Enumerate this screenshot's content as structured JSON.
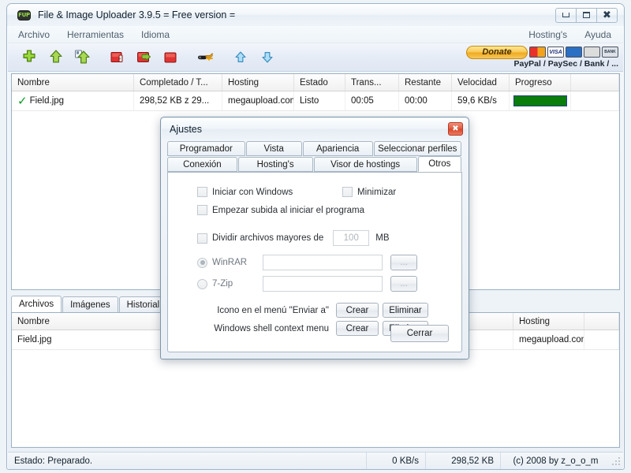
{
  "window": {
    "title": "File & Image Uploader 3.9.5  = Free version =",
    "app_icon": "FUP",
    "buttons": {
      "minimize": "minimize-icon",
      "maximize": "maximize-icon",
      "close": "close-icon"
    }
  },
  "menubar": {
    "left": [
      "Archivo",
      "Herramientas",
      "Idioma"
    ],
    "right": [
      "Hosting's",
      "Ayuda"
    ]
  },
  "toolbar": {
    "icons": [
      "add-file-icon",
      "upload-icon",
      "upload-queue-icon",
      "delete-icon",
      "resume-icon",
      "stop-icon",
      "settings-key-icon",
      "move-up-icon",
      "move-down-icon"
    ],
    "donate_label": "Donate",
    "donate_caption": "PayPal / PaySec / Bank / ...",
    "cards": [
      "MC",
      "VISA",
      "AMEX",
      "DISC",
      "BANK"
    ]
  },
  "upper_grid": {
    "columns": [
      "Nombre",
      "Completado / T...",
      "Hosting",
      "Estado",
      "Trans...",
      "Restante",
      "Velocidad",
      "Progreso",
      ""
    ],
    "rows": [
      {
        "status_icon": "check-icon",
        "name": "Field.jpg",
        "completed": "298,52 KB z 29...",
        "hosting": "megaupload.com",
        "estado": "Listo",
        "transcurrido": "00:05",
        "restante": "00:00",
        "velocidad": "59,6 KB/s",
        "progreso_percent": 100
      }
    ]
  },
  "lower_panel": {
    "tabs": [
      {
        "label": "Archivos",
        "active": true
      },
      {
        "label": "Imágenes",
        "active": false
      },
      {
        "label": "Historial de s",
        "active": false
      }
    ],
    "columns": [
      "Nombre",
      "Hosting",
      ""
    ],
    "rows": [
      {
        "name": "Field.jpg",
        "hosting": "megaupload.com"
      }
    ]
  },
  "statusbar": {
    "status": "Estado: Preparado.",
    "speed": "0 KB/s",
    "size": "298,52 KB",
    "copyright": "(c) 2008 by z_o_o_m"
  },
  "dialog": {
    "title": "Ajustes",
    "close_icon": "close-icon",
    "tabs_row1": [
      {
        "label": "Programador",
        "active": false
      },
      {
        "label": "Vista",
        "active": false
      },
      {
        "label": "Apariencia",
        "active": false
      },
      {
        "label": "Seleccionar perfiles",
        "active": false
      }
    ],
    "tabs_row2": [
      {
        "label": "Conexión",
        "active": false
      },
      {
        "label": "Hosting's",
        "active": false
      },
      {
        "label": "Visor de hostings",
        "active": false
      },
      {
        "label": "Otros",
        "active": true
      }
    ],
    "checkboxes": [
      {
        "label": "Iniciar con Windows",
        "checked": false
      },
      {
        "label": "Minimizar",
        "checked": false
      },
      {
        "label": "Empezar subida al iniciar el programa",
        "checked": false
      },
      {
        "label": "Dividir archivos mayores de",
        "checked": false
      }
    ],
    "split_size_value": "100",
    "split_size_unit": "MB",
    "archivers": [
      {
        "label": "WinRAR",
        "selected": true,
        "path": "",
        "browse_label": "..."
      },
      {
        "label": "7-Zip",
        "selected": false,
        "path": "",
        "browse_label": "..."
      }
    ],
    "shortcut_rows": [
      {
        "label": "Icono en el menú \"Enviar a\"",
        "create": "Crear",
        "remove": "Eliminar"
      },
      {
        "label": "Windows shell context menu",
        "create": "Crear",
        "remove": "Eliminar"
      }
    ],
    "close_button_label": "Cerrar"
  },
  "colors": {
    "accent": "#f0a81c",
    "progress_green": "#0a7d0a",
    "check_green": "#0f9b28",
    "dialog_close_red": "#d8452a",
    "frame_border": "#9fb4c8"
  }
}
